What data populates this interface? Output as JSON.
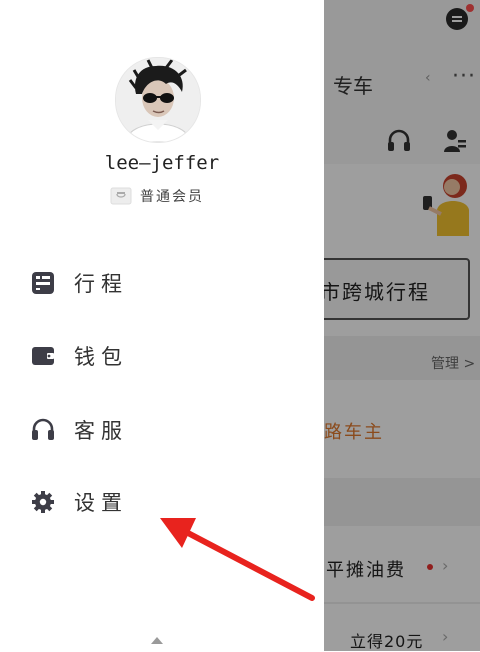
{
  "drawer": {
    "username": "lee—jeffer",
    "member_label": "普通会员",
    "menu": [
      {
        "label": "行程",
        "icon": "list-icon"
      },
      {
        "label": "钱包",
        "icon": "wallet-icon"
      },
      {
        "label": "客服",
        "icon": "headset-icon"
      },
      {
        "label": "设置",
        "icon": "gear-icon"
      }
    ]
  },
  "background": {
    "tab_special": "专车",
    "more_label": "···",
    "cross_city": "市跨城行程",
    "manage": "管理 >",
    "owner": "路车主",
    "fuel": "平摊油费",
    "bonus": "立得20元"
  },
  "colors": {
    "accent_orange": "#e07a2e",
    "notification_red": "#e8312f",
    "annotation_arrow": "#e8231e",
    "icon_dark": "#3d3d47"
  }
}
